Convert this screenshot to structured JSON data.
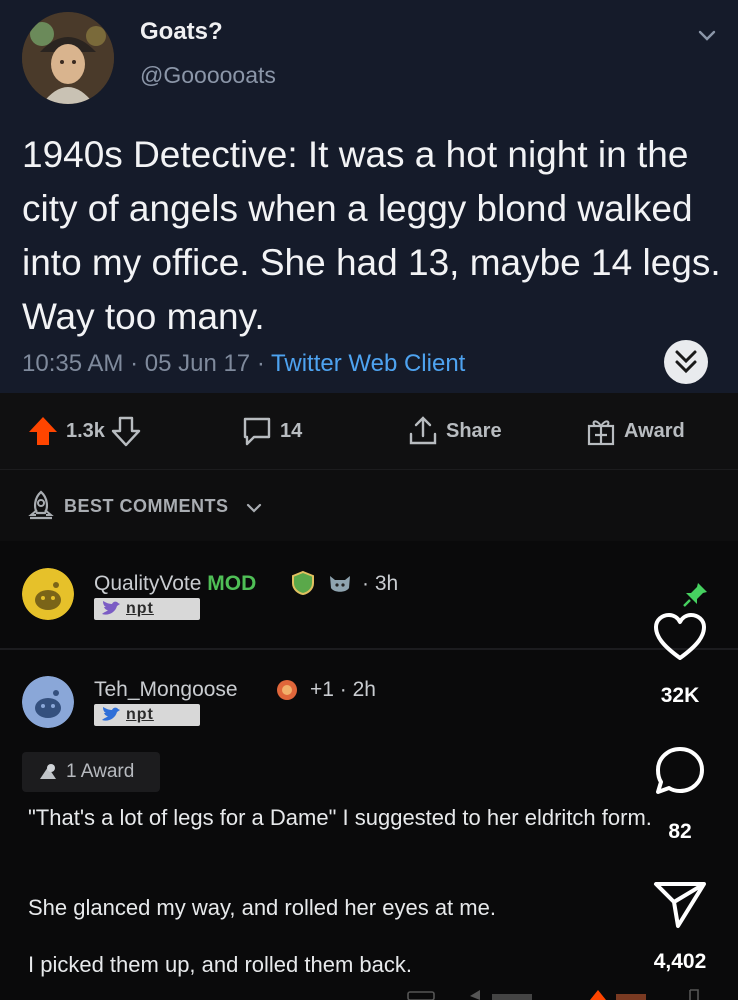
{
  "tweet": {
    "display_name": "Goats?",
    "handle": "@Goooooats",
    "text": "1940s Detective: It was a hot night in the city of angels when a leggy blond walked into my office. She had 13, maybe 14 legs. Way too many.",
    "time_date": "10:35 AM · 05 Jun 17 · ",
    "client": "Twitter Web Client"
  },
  "actions": {
    "votes": "1.3k",
    "comments": "14",
    "share_label": "Share",
    "award_label": "Award"
  },
  "sort": {
    "label": "BEST COMMENTS"
  },
  "comments": [
    {
      "username": "QualityVote",
      "mod_label": "MOD",
      "age": "· 3h",
      "flair": "npt"
    },
    {
      "username": "Teh_Mongoose",
      "score": "+1 · 2h",
      "flair": "npt",
      "award": "1 Award",
      "paragraphs": [
        "\"That's a lot of legs for a Dame\" I suggested to her eldritch form.",
        "She glanced my way, and rolled her eyes at me.",
        "I picked them up, and rolled them back."
      ]
    }
  ],
  "overlay": {
    "likes": "32K",
    "comments": "82",
    "shares": "4,402"
  },
  "colors": {
    "upvote": "#ff4500",
    "link": "#4ea3f0",
    "mod": "#4fbf56",
    "pin": "#46d160"
  }
}
